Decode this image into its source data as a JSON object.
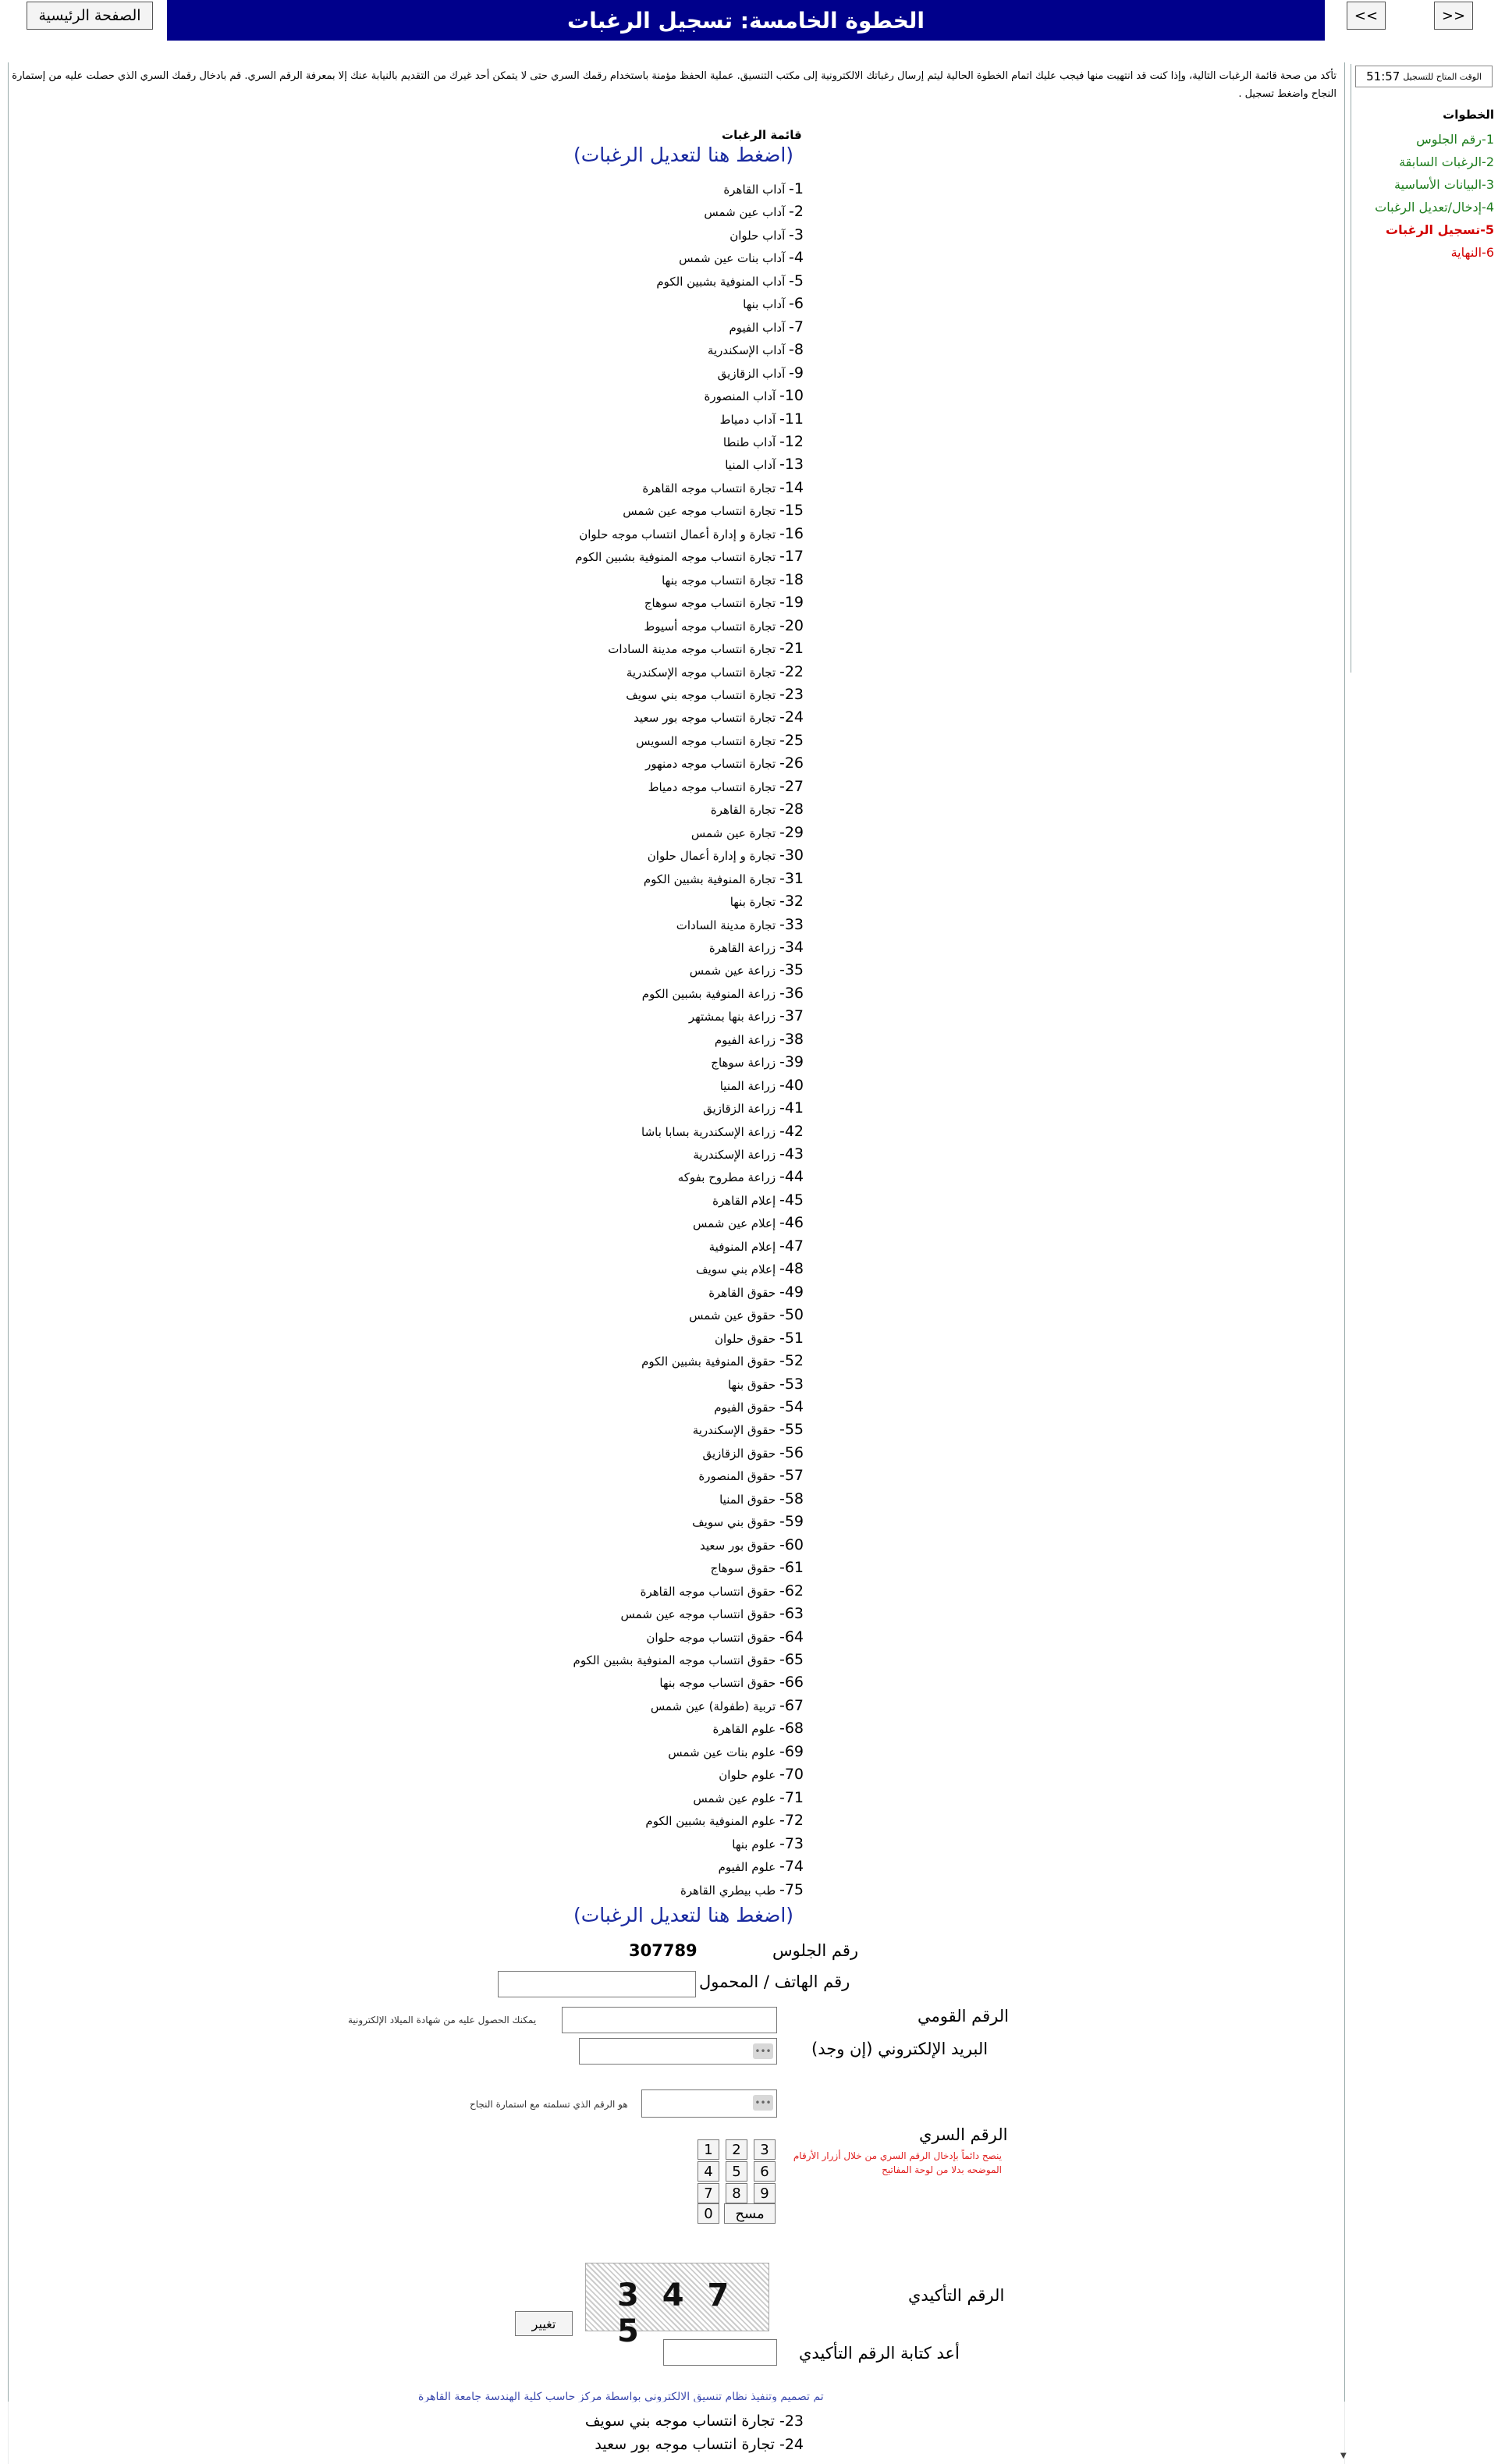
{
  "topbar": {
    "home_label": "الصفحة الرئيسية",
    "title": "الخطوة الخامسة: تسجيل الرغبات",
    "next_label": "<<",
    "prev_label": ">>"
  },
  "sidebar": {
    "timer_label": "الوقت المتاح للتسجيل",
    "timer_value": "51:57",
    "steps_title": "الخطوات",
    "steps": [
      {
        "num": "1-",
        "label": "رقم الجلوس",
        "state": "done"
      },
      {
        "num": "2-",
        "label": "الرغبات السابقة",
        "state": "done"
      },
      {
        "num": "3-",
        "label": "البيانات الأساسية",
        "state": "done"
      },
      {
        "num": "4-",
        "label": "إدخال/تعديل الرغبات",
        "state": "done"
      },
      {
        "num": "5-",
        "label": "تسجيل الرغبات",
        "state": "current"
      },
      {
        "num": "6-",
        "label": "النهاية",
        "state": "next"
      }
    ]
  },
  "main": {
    "intro": "تأكد من صحة قائمة الرغبات التالية، وإذا كنت قد انتهيت منها فيجب عليك اتمام الخطوة الحالية ليتم إرسال رغباتك الالكترونية إلى مكتب التنسيق. عملية الحفظ مؤمنة باستخدام رقمك السري حتى لا يتمكن أحد غيرك من التقديم بالنيابة عنك إلا بمعرفة الرقم السري. قم بادخال رقمك السري الذي حصلت عليه من إستمارة النجاح واضغط تسجيل .",
    "list_title": "قائمة الرغبات",
    "edit_link": "(اضغط هنا لتعديل الرغبات)",
    "wishes": [
      "آداب القاهرة",
      "آداب عين شمس",
      "آداب حلوان",
      "آداب بنات عين شمس",
      "آداب المنوفية بشبين الكوم",
      "آداب بنها",
      "آداب الفيوم",
      "آداب الإسكندرية",
      "آداب الزقازيق",
      "آداب المنصورة",
      "آداب دمياط",
      "آداب طنطا",
      "آداب المنيا",
      "تجارة انتساب موجه القاهرة",
      "تجارة انتساب موجه عين شمس",
      "تجارة و إدارة أعمال انتساب موجه حلوان",
      "تجارة انتساب موجه المنوفية بشبين الكوم",
      "تجارة انتساب موجه بنها",
      "تجارة انتساب موجه سوهاج",
      "تجارة انتساب موجه أسيوط",
      "تجارة انتساب موجه مدينة السادات",
      "تجارة انتساب موجه الإسكندرية",
      "تجارة انتساب موجه بني سويف",
      "تجارة انتساب موجه بور سعيد",
      "تجارة انتساب موجه السويس",
      "تجارة انتساب موجه دمنهور",
      "تجارة انتساب موجه دمياط",
      "تجارة القاهرة",
      "تجارة عين شمس",
      "تجارة و إدارة أعمال حلوان",
      "تجارة المنوفية بشبين الكوم",
      "تجارة بنها",
      "تجارة مدينة السادات",
      "زراعة القاهرة",
      "زراعة عين شمس",
      "زراعة المنوفية بشبين الكوم",
      "زراعة بنها بمشتهر",
      "زراعة الفيوم",
      "زراعة سوهاج",
      "زراعة المنيا",
      "زراعة الزقازيق",
      "زراعة الإسكندرية بسابا باشا",
      "زراعة الإسكندرية",
      "زراعة مطروح بفوكه",
      "إعلام القاهرة",
      "إعلام عين شمس",
      "إعلام المنوفية",
      "إعلام بني سويف",
      "حقوق القاهرة",
      "حقوق عين شمس",
      "حقوق حلوان",
      "حقوق المنوفية بشبين الكوم",
      "حقوق بنها",
      "حقوق الفيوم",
      "حقوق الإسكندرية",
      "حقوق الزقازيق",
      "حقوق المنصورة",
      "حقوق المنيا",
      "حقوق بني سويف",
      "حقوق بور سعيد",
      "حقوق سوهاج",
      "حقوق انتساب موجه القاهرة",
      "حقوق انتساب موجه عين شمس",
      "حقوق انتساب موجه حلوان",
      "حقوق انتساب موجه المنوفية بشبين الكوم",
      "حقوق انتساب موجه بنها",
      "تربية (طفولة) عين شمس",
      "علوم القاهرة",
      "علوم بنات عين شمس",
      "علوم حلوان",
      "علوم عين شمس",
      "علوم المنوفية بشبين الكوم",
      "علوم بنها",
      "علوم الفيوم",
      "طب بيطري القاهرة"
    ]
  },
  "form": {
    "seat_label": "رقم الجلوس",
    "seat_value": "307789",
    "phone_label": "رقم الهاتف / المحمول",
    "phone_value": "",
    "national_id_label": "الرقم القومي",
    "national_id_value": "",
    "national_id_hint": "يمكنك الحصول عليه من شهادة الميلاد الإلكترونية",
    "email_label": "البريد الإلكتروني (إن وجد)",
    "email_value": "",
    "success_hint": "هو الرقم الذي تسلمته مع استمارة النجاح",
    "pin_label": "الرقم السري",
    "pin_note": "ينصح دائماً بإدخال الرقم السري من خلال أزرار الأرقام الموضحه بدلا من لوحة المفاتيح",
    "keypad": [
      "1",
      "2",
      "3",
      "4",
      "5",
      "6",
      "7",
      "8",
      "9",
      "0"
    ],
    "clear_label": "مسح",
    "captcha_label": "الرقم التأكيدي",
    "captcha_text": "3 4 7 5",
    "change_label": "تغيير",
    "captcha_repeat_label": "أعد كتابة الرقم التأكيدي",
    "captcha_repeat_value": ""
  },
  "footer": {
    "text": "تم تصميم وتنفيذ نظام تنسيق الالكتروني بواسطة مركز حاسب كلية الهندسة جامعة القاهرة",
    "overlay_lines": [
      "23- تجارة انتساب موجه بني سويف",
      "24- تجارة انتساب موجه بور سعيد"
    ]
  }
}
